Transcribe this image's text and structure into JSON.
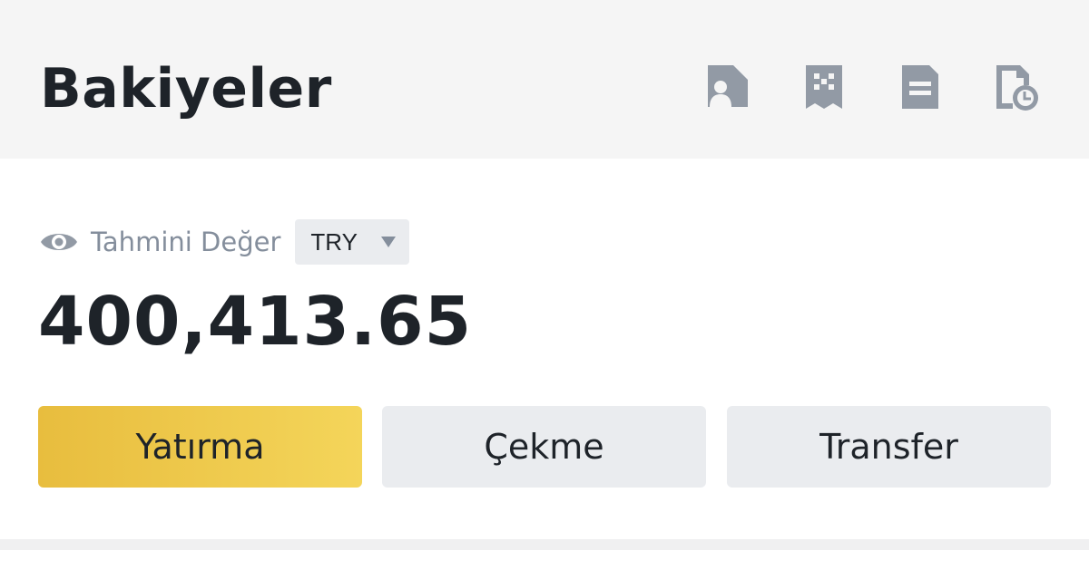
{
  "header": {
    "title": "Bakiyeler",
    "icons": [
      "user-card-icon",
      "building-icon",
      "document-icon",
      "history-icon"
    ]
  },
  "estimate": {
    "label": "Tahmini Değer",
    "currency": "TRY",
    "balance": "400,413.65"
  },
  "actions": {
    "deposit_label": "Yatırma",
    "withdraw_label": "Çekme",
    "transfer_label": "Transfer"
  },
  "colors": {
    "primary_start": "#e8bd3e",
    "primary_end": "#f4d55a",
    "secondary_bg": "#eaecef",
    "icon_gray": "#929aa5",
    "text_dark": "#1e2329",
    "text_muted": "#848e9c"
  }
}
